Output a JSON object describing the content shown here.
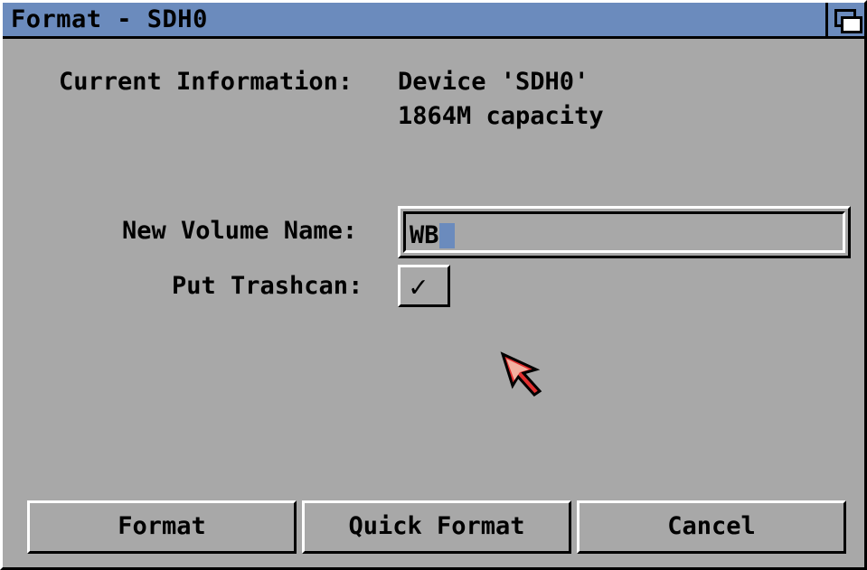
{
  "window": {
    "title": "Format - SDH0"
  },
  "info": {
    "label": "Current Information:",
    "device": "Device 'SDH0'",
    "capacity": "1864M capacity"
  },
  "form": {
    "volume_label": "New Volume Name:",
    "volume_value": "WB",
    "trashcan_label": "Put Trashcan:",
    "trashcan_checked": true,
    "check_glyph": "✓"
  },
  "buttons": {
    "format": "Format",
    "quick_format": "Quick Format",
    "cancel": "Cancel"
  },
  "colors": {
    "background": "#a8a8a8",
    "titlebar": "#6b8bbd",
    "pointer": "#e23030"
  },
  "icons": {
    "depth": "depth-gadget-icon",
    "pointer": "mouse-pointer-icon"
  }
}
